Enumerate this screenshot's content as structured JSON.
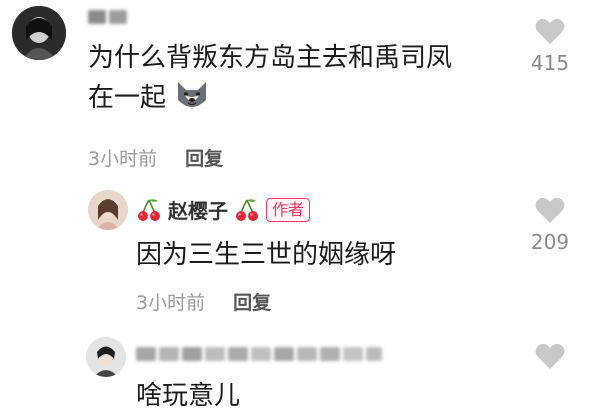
{
  "comments": [
    {
      "text_line1": "为什么背叛东方岛主去和禹司凤",
      "text_line2": "在一起",
      "emoji": "husky-dog-emoji",
      "time": "3小时前",
      "reply_label": "回复",
      "likes": "415"
    },
    {
      "author": "赵樱子",
      "author_badge": "作者",
      "decor_icon": "cherry-icon",
      "text": "因为三生三世的姻缘呀",
      "time": "3小时前",
      "reply_label": "回复",
      "likes": "209"
    },
    {
      "text": "啥玩意儿",
      "likes": ""
    }
  ],
  "colors": {
    "accent": "#ff3366",
    "like_icon": "#c8c8c8",
    "meta_text": "#9a9a9a"
  }
}
